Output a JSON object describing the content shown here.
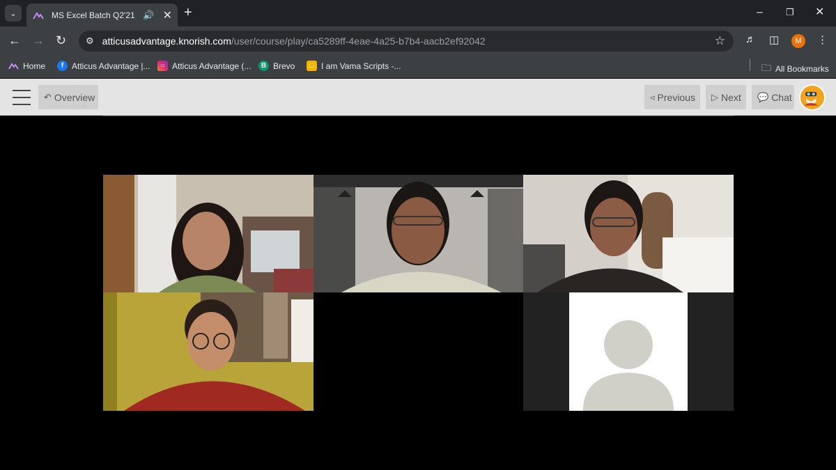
{
  "browser": {
    "tab": {
      "title": "MS Excel Batch Q2'21",
      "favicon": "knorish-logo-icon"
    },
    "url": {
      "host": "atticusadvantage.knorish.com",
      "path": "/user/course/play/ca5289ff-4eae-4a25-b7b4-aacb2ef92042"
    },
    "profile_initial": "M",
    "bookmarks": [
      {
        "label": "Home",
        "icon": "knorish-logo-icon"
      },
      {
        "label": "Atticus Advantage |...",
        "icon": "facebook-icon"
      },
      {
        "label": "Atticus Advantage (...",
        "icon": "instagram-icon"
      },
      {
        "label": "Brevo",
        "icon": "brevo-icon"
      },
      {
        "label": "I am Vama Scripts -...",
        "icon": "google-slides-icon"
      }
    ],
    "all_bookmarks": "All Bookmarks"
  },
  "app": {
    "overview_label": "Overview",
    "previous_label": "Previous",
    "next_label": "Next",
    "chat_label": "Chat"
  },
  "video": {
    "participants": [
      {
        "slot": "top-left"
      },
      {
        "slot": "top-center"
      },
      {
        "slot": "top-right"
      },
      {
        "slot": "bottom-left"
      },
      {
        "slot": "bottom-right",
        "placeholder": "default-avatar-icon"
      }
    ]
  },
  "colors": {
    "profile": "#e8710a",
    "avatar": "#f3a41c"
  }
}
